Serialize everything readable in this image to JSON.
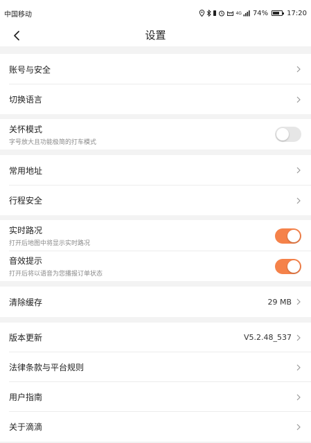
{
  "status_bar": {
    "carrier": "中国移动",
    "icons": [
      "location-icon",
      "bluetooth-icon",
      "alarm-icon",
      "cat-icon",
      "signal-icon",
      "battery-icon"
    ],
    "signal_text": "4G",
    "battery_text": "74%",
    "battery_level": 0.74,
    "time": "17:20"
  },
  "header": {
    "title": "设置"
  },
  "colors": {
    "toggle_on": "#f5824a",
    "toggle_off": "#e6e6e6",
    "background": "#f3f3f3"
  },
  "items": {
    "account_security": {
      "label": "账号与安全"
    },
    "switch_language": {
      "label": "切换语言"
    },
    "care_mode": {
      "label": "关怀模式",
      "desc": "字号放大且功能极简的打车模式",
      "enabled": false
    },
    "common_address": {
      "label": "常用地址"
    },
    "trip_safety": {
      "label": "行程安全"
    },
    "realtime_traffic": {
      "label": "实时路况",
      "desc": "打开后地图中将显示实时路况",
      "enabled": true
    },
    "sound_prompt": {
      "label": "音效提示",
      "desc": "打开后将以语音为您播报订单状态",
      "enabled": true
    },
    "clear_cache": {
      "label": "清除缓存",
      "value": "29 MB"
    },
    "version_update": {
      "label": "版本更新",
      "value": "V5.2.48_537"
    },
    "legal_terms": {
      "label": "法律条款与平台规则"
    },
    "user_guide": {
      "label": "用户指南"
    },
    "about": {
      "label": "关于滴滴"
    }
  }
}
